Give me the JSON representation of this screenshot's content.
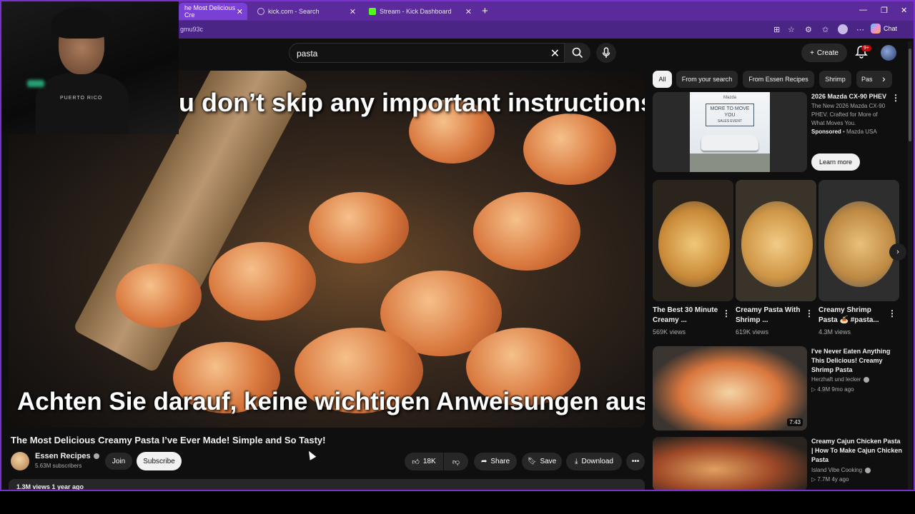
{
  "browser": {
    "tabs": [
      {
        "label": "he Most Delicious Cre"
      },
      {
        "label": "kick.com - Search"
      },
      {
        "label": "Stream - Kick Dashboard"
      }
    ],
    "url_fragment": "gmu93c",
    "chat_label": "Chat"
  },
  "header": {
    "search_query": "pasta",
    "create_label": "Create",
    "notif_badge": "9+"
  },
  "video": {
    "subtitle_top": "u don’t skip any important instructions,",
    "subtitle_bottom": "Achten Sie darauf, keine wichtigen Anweisungen auszulassen",
    "title": "The Most Delicious Creamy Pasta I’ve Ever Made! Simple and So Tasty!",
    "channel": "Essen Recipes",
    "subscribers": "5.63M subscribers",
    "join_label": "Join",
    "subscribe_label": "Subscribe",
    "likes": "18K",
    "share_label": "Share",
    "save_label": "Save",
    "download_label": "Download",
    "views_age": "1.3M views  1 year ago"
  },
  "webcam": {
    "shirt_text": "PUERTO RICO"
  },
  "chips": [
    "All",
    "From your search",
    "From Essen Recipes",
    "Shrimp",
    "Pas"
  ],
  "ad": {
    "image_text": "MORE TO MOVE YOU",
    "image_brand": "Mazda",
    "image_sub": "SALES EVENT",
    "title": "2026 Mazda CX-90 PHEV",
    "description": "The New 2026 Mazda CX-90 PHEV. Crafted for More of What Moves You.",
    "sponsored": "Sponsored",
    "advertiser": " • Mazda USA",
    "cta": "Learn more"
  },
  "shorts": [
    {
      "title": "The Best 30 Minute Creamy ...",
      "views": "569K views",
      "color": "#e8b04a"
    },
    {
      "title": "Creamy Pasta With Shrimp ...",
      "views": "619K views",
      "color": "#e9b86a"
    },
    {
      "title": "Creamy Shrimp Pasta 🍝 #pasta...",
      "views": "4.3M views",
      "color": "#d9a860"
    }
  ],
  "recommended": [
    {
      "title": "I've Never Eaten Anything This Delicious! Creamy Shrimp Pasta",
      "channel": "Herzhaft und lecker",
      "meta": "▷ 4.9M  9mo ago",
      "duration": "7:43"
    },
    {
      "title": "Creamy Cajun Chicken Pasta | How To Make Cajun Chicken Pasta",
      "channel": "Island Vibe Cooking",
      "meta": "▷ 7.7M  4y ago",
      "duration": ""
    }
  ]
}
